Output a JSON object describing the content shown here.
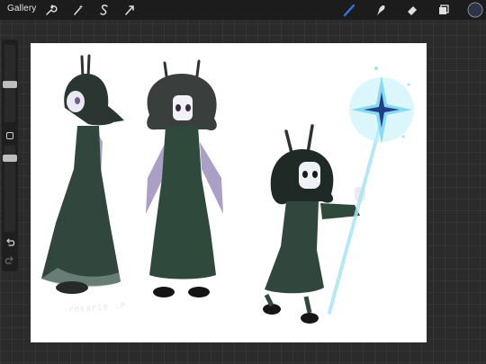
{
  "topbar": {
    "gallery_label": "Gallery",
    "tools": [
      {
        "name": "actions",
        "icon": "wrench-icon"
      },
      {
        "name": "adjustments",
        "icon": "magic-wand-icon"
      },
      {
        "name": "selection",
        "icon": "selection-s-icon"
      },
      {
        "name": "transform",
        "icon": "arrow-cursor-icon"
      },
      {
        "name": "brush",
        "icon": "brush-icon",
        "active": true,
        "color": "#2f7bf2"
      },
      {
        "name": "smudge",
        "icon": "smudge-finger-icon"
      },
      {
        "name": "eraser",
        "icon": "eraser-icon"
      },
      {
        "name": "layers",
        "icon": "layers-icon"
      },
      {
        "name": "color",
        "icon": "color-swatch-icon",
        "color": "#2d3348"
      }
    ]
  },
  "sidebar": {
    "brush_size_level": 0.2,
    "opacity_level": 0.2,
    "icons": [
      "modify-square-icon",
      "undo-icon",
      "redo-icon"
    ]
  },
  "canvas": {
    "artwork": "three character sketches in dark green dresses with rabbit ears, one holding a glowing star staff",
    "signature_text": "rosarie :P",
    "colors": {
      "dress": "#2f4a3d",
      "hair": "#2a3431",
      "wing": "#8e7fb2",
      "star": "#9fe2f2"
    }
  }
}
